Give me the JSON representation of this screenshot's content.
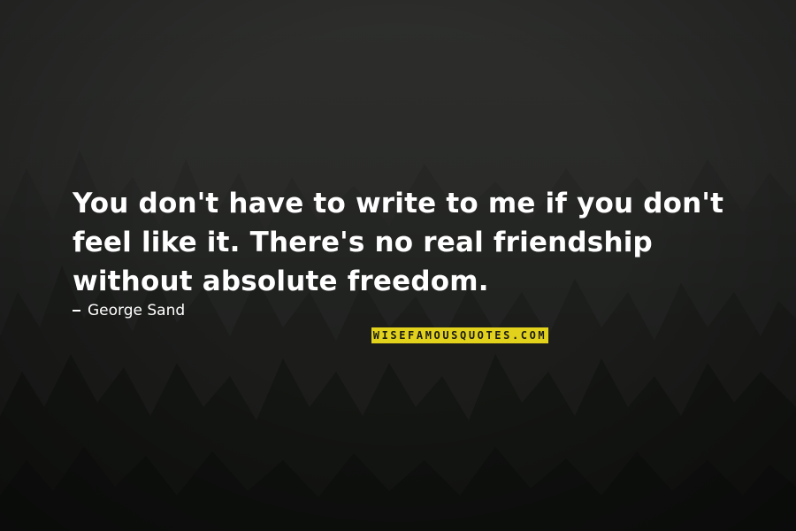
{
  "quote": {
    "text": "You don't have to write to me if you don't\nfeel like it. There's no real friendship\nwithout absolute freedom."
  },
  "author": {
    "prefix_icon": "dash-icon",
    "name": "George Sand"
  },
  "watermark": {
    "text": "WISEFAMOUSQUOTES.COM",
    "color": "#e3d21c"
  },
  "colors": {
    "text": "#ffffff",
    "background": "#2b2c2a"
  }
}
